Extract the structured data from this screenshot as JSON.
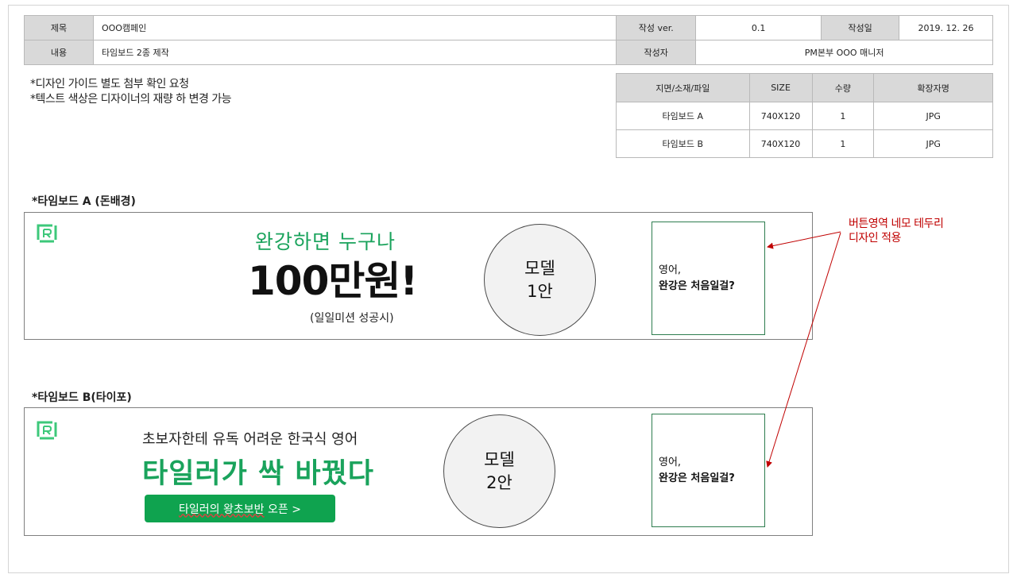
{
  "info": {
    "title_label": "제목",
    "title_value": "OOO캠페인",
    "version_label": "작성 ver.",
    "version_value": "0.1",
    "date_label": "작성일",
    "date_value": "2019. 12. 26",
    "content_label": "내용",
    "content_value": "타임보드 2종 제작",
    "author_label": "작성자",
    "author_value": "PM본부 OOO 매니저"
  },
  "notes": [
    "*디자인 가이드 별도 첨부 확인 요청",
    "*텍스트 색상은 디자이너의 재량 하 변경 가능"
  ],
  "spec": {
    "headers": [
      "지면/소재/파일",
      "SIZE",
      "수량",
      "확장자명"
    ],
    "rows": [
      [
        "타임보드 A",
        "740X120",
        "1",
        "JPG"
      ],
      [
        "타임보드 B",
        "740X120",
        "1",
        "JPG"
      ]
    ]
  },
  "board_a": {
    "section_title": "*타임보드 A (돈배경)",
    "headline": "완강하면 누구나",
    "big": "100만원!",
    "sub": "(일일미션 성공시)",
    "model_line1": "모델",
    "model_line2": "1안",
    "button_line1": "영어,",
    "button_line2": "완강은 처음일걸?"
  },
  "board_b": {
    "section_title": "*타임보드 B(타이포)",
    "headline": "초보자한테 유독 어려운 한국식 영어",
    "big": "타일러가 싹 바꿨다",
    "cta_underlined": "타일러의 왕초보반",
    "cta_rest": " 오픈 >",
    "model_line1": "모델",
    "model_line2": "2안",
    "button_line1": "영어,",
    "button_line2": "완강은 처음일걸?"
  },
  "callout": {
    "line1": "버튼영역 네모 테두리",
    "line2": "디자인 적용"
  },
  "colors": {
    "brand_green": "#1aa35c",
    "cta_green": "#0fa34f",
    "callout_red": "#c00000",
    "header_gray": "#d9d9d9"
  }
}
